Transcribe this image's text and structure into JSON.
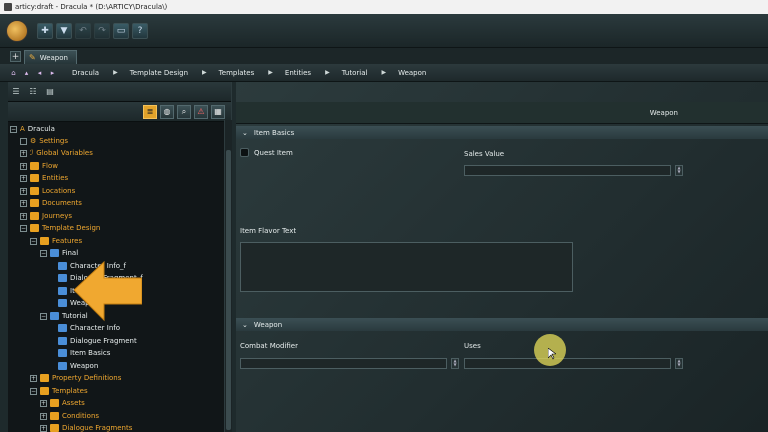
{
  "window": {
    "title": "articy:draft - Dracula * (D:\\ARTICY\\Dracula\\)"
  },
  "toolbar": {
    "icons": [
      "app-logo-icon",
      "new-icon",
      "save-icon",
      "undo-icon",
      "redo-icon",
      "window-icon",
      "help-icon"
    ]
  },
  "tabs": {
    "add": "+",
    "active": "Weapon"
  },
  "breadcrumb": {
    "items": [
      "Dracula",
      "Template Design",
      "Templates",
      "Entities",
      "Tutorial",
      "Weapon"
    ]
  },
  "tree": {
    "root": "Dracula",
    "items": [
      {
        "label": "Settings"
      },
      {
        "label": "Global Variables"
      },
      {
        "label": "Flow"
      },
      {
        "label": "Entities"
      },
      {
        "label": "Locations"
      },
      {
        "label": "Documents"
      },
      {
        "label": "Journeys"
      },
      {
        "label": "Template Design"
      },
      {
        "label": "Features"
      },
      {
        "label": "Final"
      },
      {
        "label": "Character Info_f"
      },
      {
        "label": "Dialogue Fragment_f"
      },
      {
        "label": "Item Basics_f"
      },
      {
        "label": "Weapon_f"
      },
      {
        "label": "Tutorial"
      },
      {
        "label": "Character Info"
      },
      {
        "label": "Dialogue Fragment"
      },
      {
        "label": "Item Basics"
      },
      {
        "label": "Weapon"
      },
      {
        "label": "Property Definitions"
      },
      {
        "label": "Templates"
      },
      {
        "label": "Assets"
      },
      {
        "label": "Conditions"
      },
      {
        "label": "Dialogue Fragments"
      }
    ]
  },
  "editor": {
    "header": "Weapon",
    "sections": [
      {
        "title": "Item Basics",
        "fields": {
          "checkbox": "Quest Item",
          "value": "Sales Value",
          "text": "Item Flavor Text"
        }
      },
      {
        "title": "Weapon",
        "fields": {
          "modifier": "Combat Modifier",
          "uses": "Uses"
        }
      }
    ]
  },
  "colors": {
    "accent": "#f0a830",
    "pointer_highlight": "#e6dc5a"
  }
}
